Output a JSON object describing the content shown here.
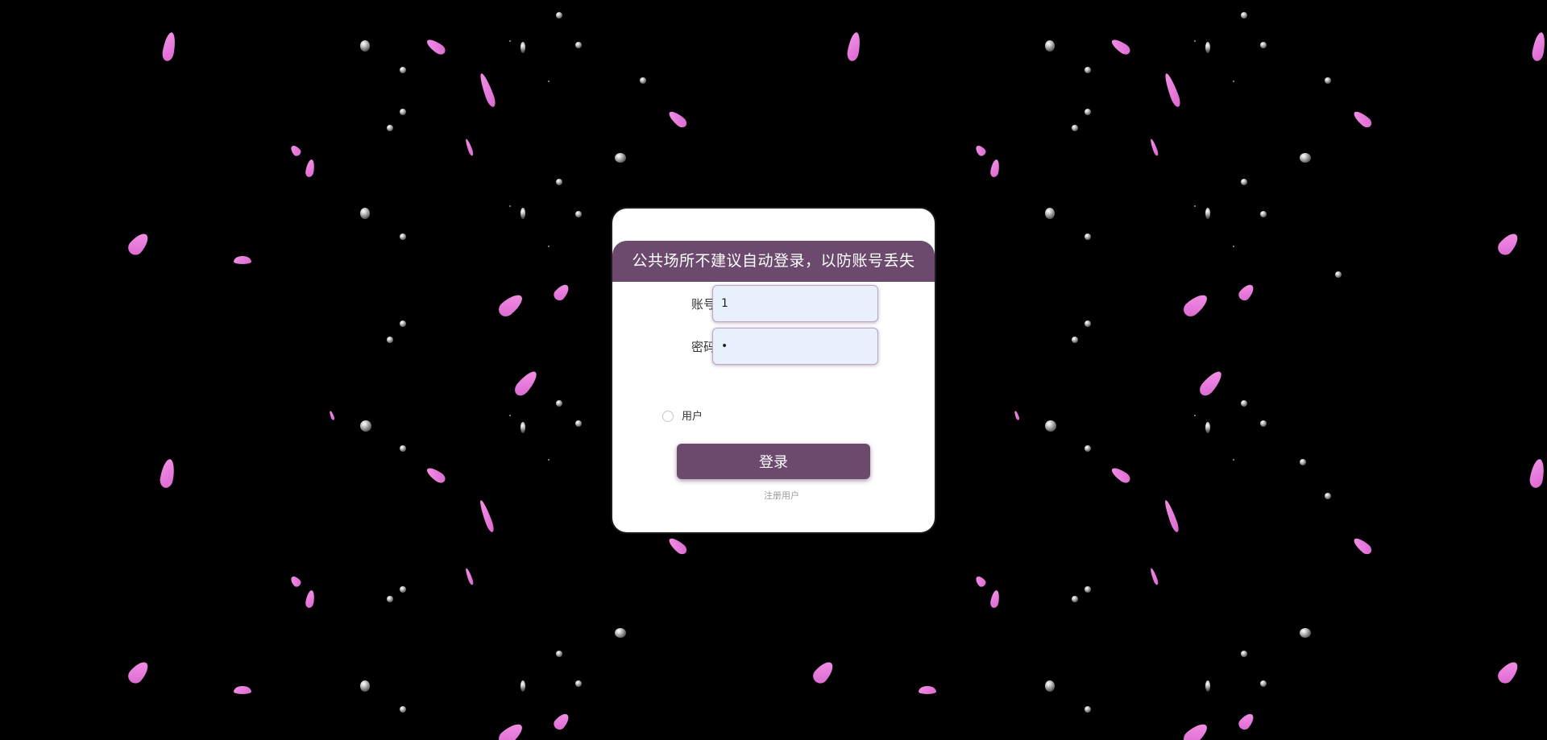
{
  "notice": {
    "text": "公共场所不建议自动登录，以防账号丢失"
  },
  "form": {
    "username": {
      "label": "账号",
      "value": "1"
    },
    "password": {
      "label": "密码",
      "value": "1"
    },
    "role": {
      "label": "用户",
      "checked": false
    },
    "login_button": "登录",
    "register_link": "注册用户"
  },
  "theme": {
    "background": "#000000",
    "accent": "#6b4a6e",
    "input_bg": "#e8f0fe",
    "petal": "#f27ee6"
  }
}
